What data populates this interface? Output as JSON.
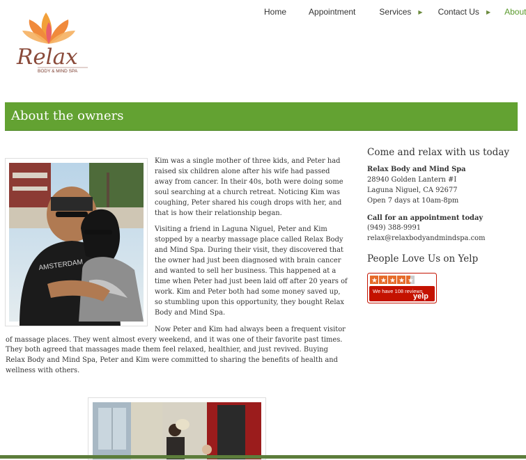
{
  "nav": {
    "items": [
      {
        "label": "Home",
        "has_arrow": false
      },
      {
        "label": "Appointment",
        "has_arrow": false
      },
      {
        "label": "Services",
        "has_arrow": true
      },
      {
        "label": "Contact Us",
        "has_arrow": true
      },
      {
        "label": "About Us",
        "has_arrow": true,
        "active": true
      }
    ]
  },
  "logo": {
    "text": "Relax",
    "subtext": "BODY & MIND SPA"
  },
  "page": {
    "title": "About the owners"
  },
  "content": {
    "paragraphs": [
      "Kim was a single mother of three kids, and Peter had raised six children alone after his wife had passed away from cancer.  In their 40s, both were doing some soul searching at a church retreat.  Noticing Kim was coughing, Peter shared his cough drops with her, and that is how their  relationship began.",
      "Visiting a friend in Laguna Niguel, Peter and Kim stopped by a nearby massage place called Relax Body and Mind Spa. During their visit, they discovered that the owner had just been diagnosed with brain cancer and wanted to sell her business.  This happened at a time when Peter had just been laid off after 20 years of work.  Kim and Peter both had some money saved up, so stumbling upon this opportunity, they bought Relax Body and Mind Spa.",
      "Now Peter and Kim had always been a frequent visitor of massage places.  They went almost every weekend, and it was one of their favorite past times.  They both agreed that massages made them feel relaxed, healthier, and just revived.  Buying Relax Body and Mind Spa, Peter and Kim were committed to sharing the benefits of health and wellness with others."
    ]
  },
  "sidebar": {
    "heading": "Come and relax with us today",
    "business_name": "Relax Body and Mind Spa",
    "address1": "28940 Golden Lantern #I",
    "address2": "Laguna Niguel, CA 92677",
    "hours": "Open 7 days at 10am-8pm",
    "call_heading": "Call for an appointment today",
    "phone": "(949) 388-9991",
    "email": "relax@relaxbodyandmindspa.com",
    "yelp_heading": "People Love Us on Yelp",
    "yelp_reviews": "We have 108 reviews",
    "yelp_brand": "yelp",
    "yelp_stars": 4.5
  },
  "colors": {
    "accent": "#63a232",
    "nav_active": "#5a9a2c",
    "yelp_red": "#c41200"
  }
}
